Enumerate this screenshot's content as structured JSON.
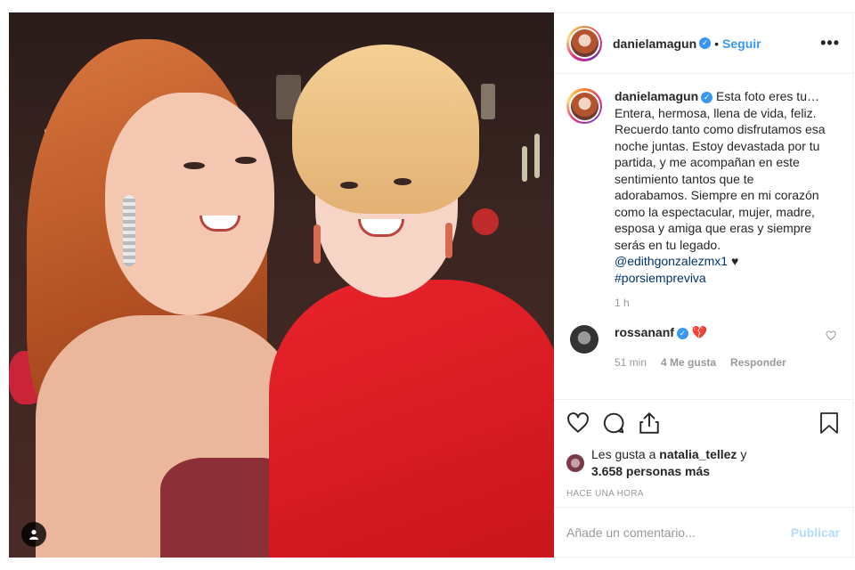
{
  "post": {
    "username": "danielamagun",
    "separator": "•",
    "follow_label": "Seguir",
    "more_label": "•••"
  },
  "caption": {
    "username": "danielamagun",
    "text": "Esta foto eres tu… Entera, hermosa, llena de vida, feliz. Recuerdo tanto como disfrutamos esa noche juntas. Estoy devastada por tu partida, y me acompañan en este sentimiento tantos que te adorabamos. Siempre en mi corazón como la espectacular, mujer, madre, esposa y amiga que eras y siempre serás en tu legado.",
    "mention": "@edithgonzalezmx1",
    "heart": "♥",
    "hashtag": "#porsiempreviva",
    "time": "1 h"
  },
  "comment": {
    "username": "rossananf",
    "text": "💔",
    "time": "51 min",
    "likes": "4 Me gusta",
    "reply_label": "Responder"
  },
  "likes": {
    "prefix": "Les gusta a ",
    "user": "natalia_tellez",
    "middle": " y",
    "count": "3.658 personas más"
  },
  "timestamp": "HACE UNA HORA",
  "add_comment": {
    "placeholder": "Añade un comentario...",
    "post_label": "Publicar"
  },
  "icons": [
    "more-icon",
    "heart-icon",
    "comment-icon",
    "share-icon",
    "bookmark-icon",
    "user-tag-icon",
    "verified-icon"
  ],
  "colors": {
    "accent": "#3897f0",
    "link": "#003569",
    "muted": "#999999",
    "post_disabled": "#b3dbff"
  }
}
